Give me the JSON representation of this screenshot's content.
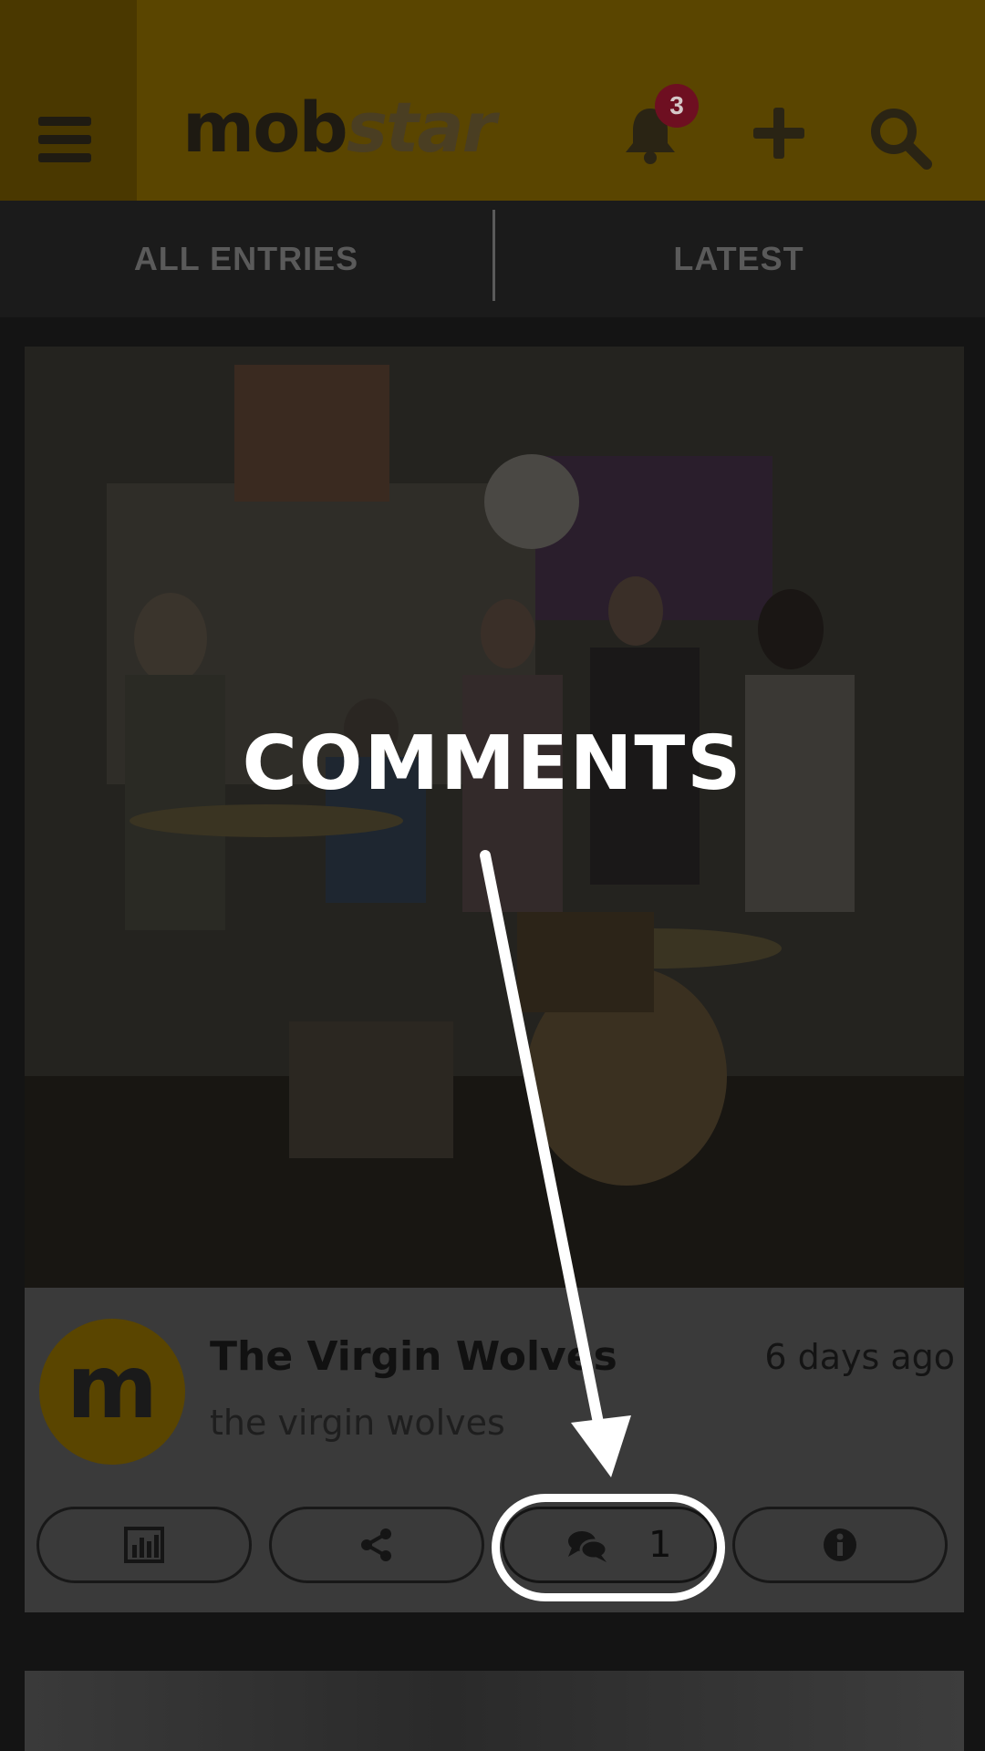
{
  "header": {
    "menu_icon": "hamburger-menu-icon",
    "logo_part1": "mob",
    "logo_part2": "star",
    "notification_icon": "bell-icon",
    "notification_count": "3",
    "add_icon": "plus-icon",
    "search_icon": "search-icon",
    "bg_color": "#5a4500"
  },
  "tabs": {
    "all_entries": "ALL ENTRIES",
    "latest": "LATEST"
  },
  "entry": {
    "title": "The Virgin Wolves",
    "subtitle": "the virgin wolves",
    "time": "6 days ago",
    "avatar_letter": "m",
    "actions": {
      "stats_icon": "bar-chart-icon",
      "share_icon": "share-icon",
      "comments_icon": "comments-icon",
      "comments_count": "1",
      "info_icon": "info-icon"
    }
  },
  "overlay": {
    "label": "COMMENTS"
  }
}
